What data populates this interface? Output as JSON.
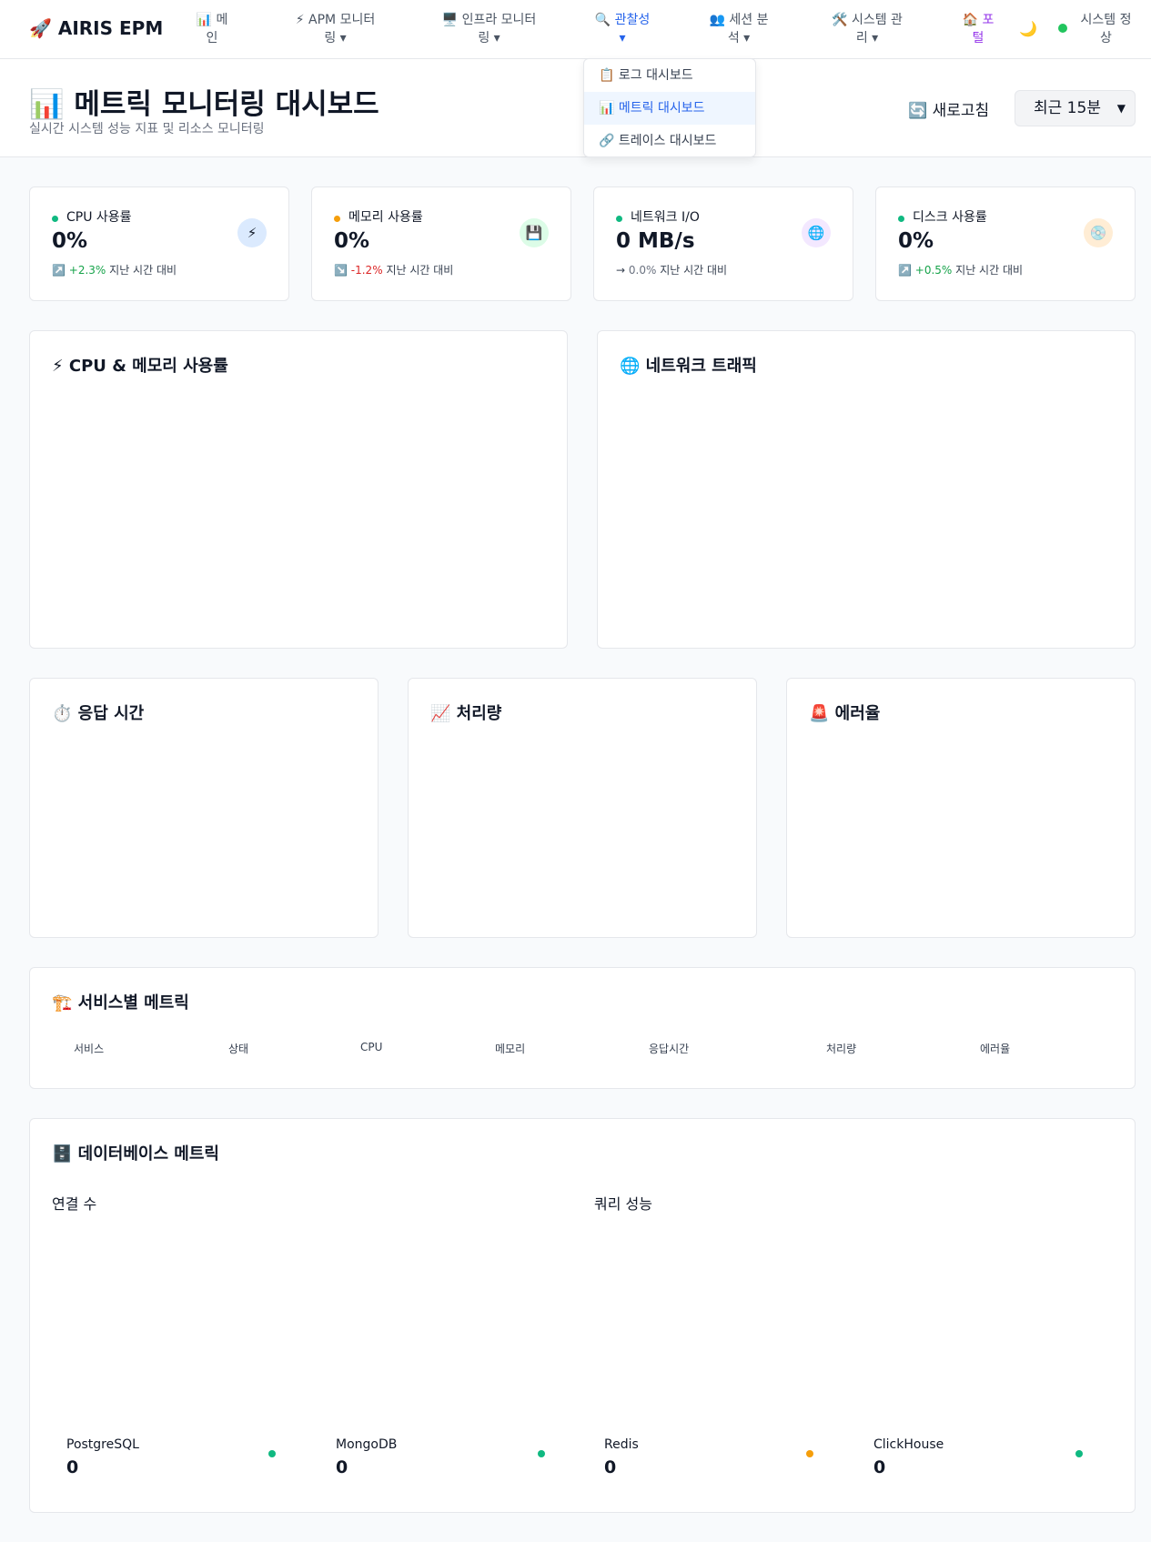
{
  "nav": {
    "brand": "🚀 AIRIS EPM",
    "items": [
      {
        "label": "📊 메\n인"
      },
      {
        "label": "⚡ APM 모니터\n링 ▾"
      },
      {
        "label": "🖥️ 인프라 모니터\n링 ▾"
      },
      {
        "label": "🔍 관찰성\n▾"
      },
      {
        "label": "👥 세션 분\n석 ▾"
      },
      {
        "label": "🛠️ 시스템 관\n리 ▾"
      },
      {
        "label": "🏠 포\n털"
      }
    ],
    "theme_icon": "🌙",
    "status": "시스템 정\n상",
    "status_color": "#22c55e"
  },
  "dropdown": {
    "items": [
      {
        "label": "📋 로그 대시보드"
      },
      {
        "label": "📊 메트릭 대시보드"
      },
      {
        "label": "🔗 트레이스 대시보드"
      }
    ]
  },
  "header": {
    "title": "📊 메트릭 모니터링 대시보드",
    "subtitle": "실시간 시스템 성능 지표 및 리소스 모니터링",
    "refresh": "🔄 새로고침",
    "range": "최근 15분"
  },
  "stats": [
    {
      "label": "CPU 사용률",
      "value": "0%",
      "arrow": "↗️",
      "change": "+2.3%",
      "suffix": "지난 시간 대비",
      "dot_color": "#10b981",
      "icon": "⚡",
      "icon_bg": "#dbeafe"
    },
    {
      "label": "메모리 사용률",
      "value": "0%",
      "arrow": "↘️",
      "change": "-1.2%",
      "suffix": "지난 시간 대비",
      "dot_color": "#f59e0b",
      "icon": "💾",
      "icon_bg": "#dcfce7"
    },
    {
      "label": "네트워크 I/O",
      "value": "0 MB/s",
      "arrow": "→",
      "change": "0.0%",
      "suffix": "지난 시간 대비",
      "dot_color": "#10b981",
      "icon": "🌐",
      "icon_bg": "#f3e8ff"
    },
    {
      "label": "디스크 사용률",
      "value": "0%",
      "arrow": "↗️",
      "change": "+0.5%",
      "suffix": "지난 시간 대비",
      "dot_color": "#10b981",
      "icon": "💿",
      "icon_bg": "#ffedd5"
    }
  ],
  "charts": {
    "cpu_mem": "⚡ CPU & 메모리 사용률",
    "network": "🌐 네트워크 트래픽",
    "response": "⏱️ 응답 시간",
    "throughput": "📈 처리량",
    "error": "🚨 에러율"
  },
  "services": {
    "title": "🏗️ 서비스별 메트릭",
    "columns": [
      "서비스",
      "상태",
      "CPU",
      "메모리",
      "응답시간",
      "처리량",
      "에러율"
    ]
  },
  "database": {
    "title": "🗄️ 데이터베이스 메트릭",
    "connections": "연결 수",
    "query_perf": "쿼리 성능",
    "items": [
      {
        "name": "PostgreSQL",
        "value": "0",
        "color": "#10b981"
      },
      {
        "name": "MongoDB",
        "value": "0",
        "color": "#10b981"
      },
      {
        "name": "Redis",
        "value": "0",
        "color": "#f59e0b"
      },
      {
        "name": "ClickHouse",
        "value": "0",
        "color": "#10b981"
      }
    ]
  }
}
